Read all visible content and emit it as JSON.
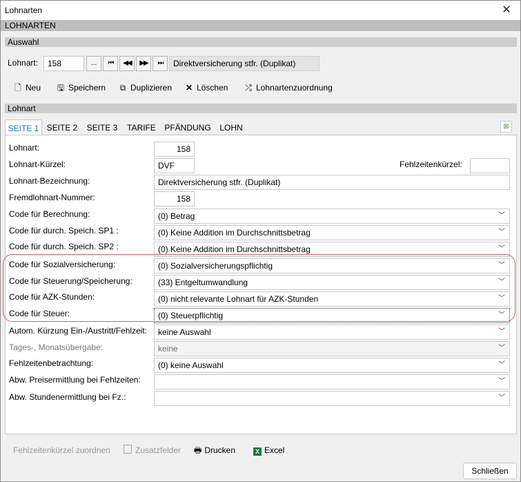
{
  "window": {
    "title": "Lohnarten",
    "close_glyph": "✕"
  },
  "header_bar": "LOHNARTEN",
  "auswahl": {
    "section_label": "Auswahl",
    "lohnart_label": "Lohnart:",
    "lohnart_value": "158",
    "browse_label": "...",
    "first_icon": "⏮",
    "prev_icon": "◀◀",
    "next_icon": "▶▶",
    "last_icon": "⏭",
    "description": "Direktversicherung stfr. (Duplikat)"
  },
  "toolbar": {
    "new_label": "Neu",
    "save_label": "Speichern",
    "duplicate_label": "Duplizieren",
    "delete_label": "Löschen",
    "assign_label": "Lohnartenzuordnung"
  },
  "lohnart_section": "Lohnart",
  "tabs": [
    "SEITE 1",
    "SEITE 2",
    "SEITE 3",
    "TARIFE",
    "PFÄNDUNG",
    "LOHN"
  ],
  "form": {
    "lohnart_label": "Lohnart:",
    "lohnart_value": "158",
    "kuerzel_label": "Lohnart-Kürzel:",
    "kuerzel_value": "DVF",
    "fehlzeiten_label": "Fehlzeitenkürzel:",
    "fehlzeiten_value": "",
    "bezeichnung_label": "Lohnart-Bezeichnung:",
    "bezeichnung_value": "Direktversicherung stfr. (Duplikat)",
    "fremd_label": "Fremdlohnart-Nummer:",
    "fremd_value": "158",
    "combos": [
      {
        "label": "Code für Berechnung:",
        "value": "(0) Betrag"
      },
      {
        "label": "Code für durch. Speich. SP1 :",
        "value": "(0) Keine Addition im Durchschnittsbetrag"
      },
      {
        "label": "Code für durch. Speich. SP2 :",
        "value": "(0) Keine Addition im Durchschnittsbetrag"
      },
      {
        "label": "Code für Sozialversicherung:",
        "value": "(0) Sozialversicherungspflichtig"
      },
      {
        "label": "Code für Steuerung/Speicherung:",
        "value": "(33) Entgeltumwandlung"
      },
      {
        "label": "Code für AZK-Stunden:",
        "value": "(0) nicht relevante Lohnart für AZK-Stunden"
      },
      {
        "label": "Code für Steuer:",
        "value": "(0) Steuerpflichtig"
      },
      {
        "label": "Autom. Kürzung Ein-/Austritt/Fehlzeit:",
        "value": "keine Auswahl"
      },
      {
        "label": "Tages-, Monatsübergabe:",
        "value": "keine"
      },
      {
        "label": "Fehlzeitenbetrachtung:",
        "value": "(0) keine Auswahl"
      },
      {
        "label": "Abw. Preisermittlung bei Fehlzeiten:",
        "value": ""
      },
      {
        "label": "Abw. Stundenermittlung bei Fz.:",
        "value": ""
      }
    ]
  },
  "bottom": {
    "fehlzeiten_btn": "Fehlzeitenkürzel zuordnen",
    "zusatz_btn": "Zusatzfelder",
    "print_btn": "Drucken",
    "excel_btn": "Excel",
    "close_btn": "Schließen"
  },
  "colors": {
    "active_tab": "#1c6fc2",
    "highlight": "#e05a5a"
  }
}
